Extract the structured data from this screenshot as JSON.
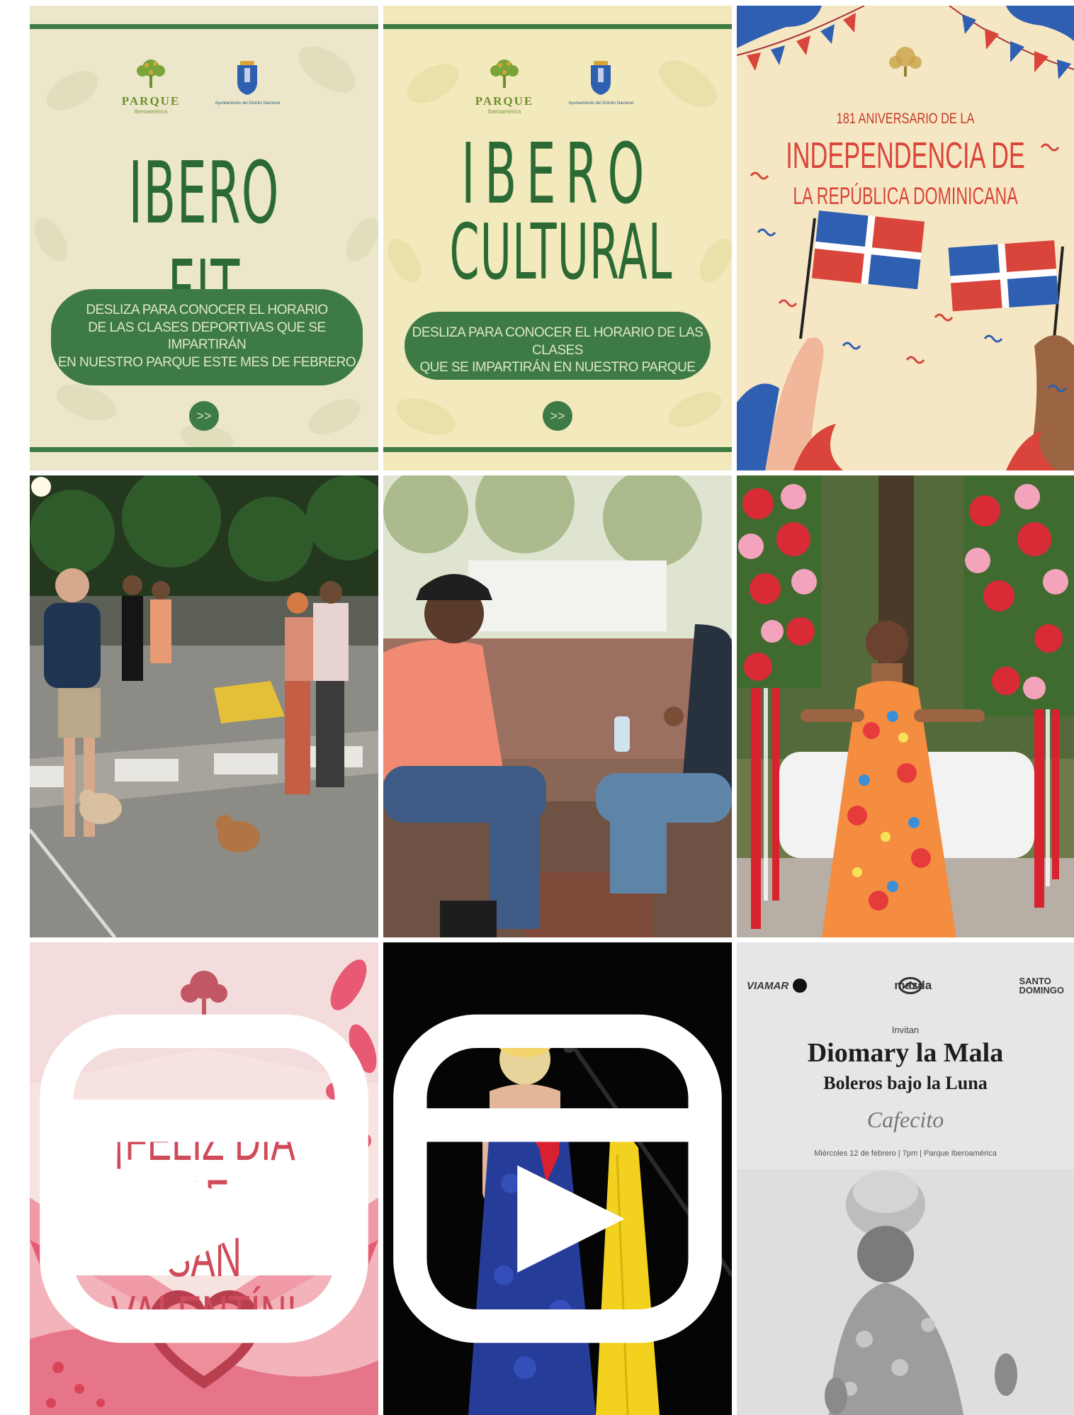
{
  "posts": {
    "ibero_fit": {
      "brand": "PARQUE",
      "brand_sub": "Iberoamérica",
      "shield_caption": "Ayuntamiento del Distrito Nacional",
      "title": "IBERO FIT",
      "pill_lines": [
        "DESLIZA PARA CONOCER EL HORARIO",
        "DE LAS CLASES DEPORTIVAS QUE SE IMPARTIRÁN",
        "EN NUESTRO PARQUE ESTE MES DE FEBRERO"
      ],
      "next_icon": ">>"
    },
    "ibero_cultural": {
      "brand": "PARQUE",
      "brand_sub": "Iberoamérica",
      "shield_caption": "Ayuntamiento del Distrito Nacional",
      "title_line1": "IBERO",
      "title_line2": "CULTURAL",
      "pill_lines": [
        "DESLIZA PARA CONOCER EL HORARIO DE LAS CLASES",
        "QUE SE IMPARTIRÁN EN NUESTRO PARQUE"
      ],
      "next_icon": ">>"
    },
    "independencia": {
      "anniversary": "181 ANIVERSARIO DE LA",
      "line1": "INDEPENDENCIA DE",
      "line2": "LA REPÚBLICA DOMINICANA"
    },
    "san_valentin": {
      "line1": "¡FELIZ DÍA DE",
      "line2": "SAN VALENTÍN!"
    },
    "diomary": {
      "sponsor1": "VIAMAR",
      "sponsor2": "mazda",
      "sponsor3_l1": "SANTO",
      "sponsor3_l2": "DOMINGO",
      "invitan": "Invitan",
      "title": "Diomary la Mala",
      "subtitle": "Boleros bajo la Luna",
      "script": "Cafecito",
      "info": "Miércoles 12 de febrero | 7pm | Parque Iberoamérica"
    }
  },
  "colors": {
    "ibero_green": "#3e7a46",
    "ibero_dark": "#2c6a35",
    "dr_red": "#d9453a",
    "dr_blue": "#2f5fb0",
    "valentine_pink": "#cf4b5a"
  },
  "icons": {
    "reel": "reel-icon",
    "leaf": "leaf-icon",
    "shield": "coat-of-arms-icon",
    "tree": "tree-logo-icon",
    "heart": "heart-icon"
  }
}
